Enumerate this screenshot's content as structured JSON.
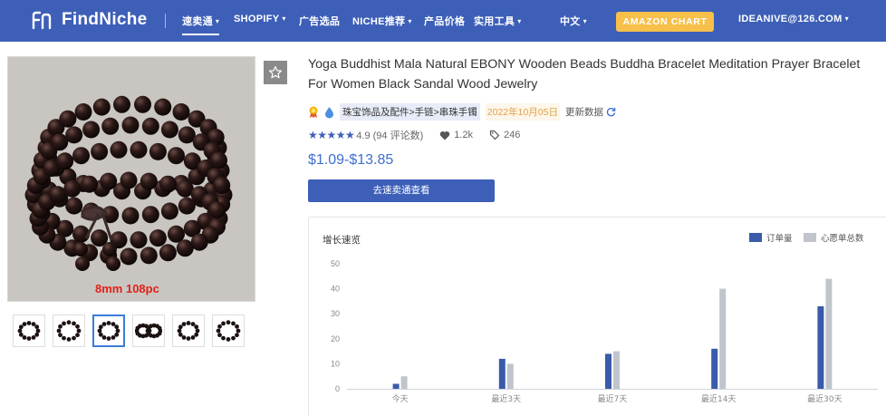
{
  "nav": {
    "brand": "FindNiche",
    "items": [
      {
        "label": "速卖通",
        "caret": true,
        "active": true
      },
      {
        "label": "SHOPIFY",
        "caret": true,
        "active": false
      },
      {
        "label": "广告选品",
        "caret": false,
        "active": false
      },
      {
        "label": "NICHE推荐",
        "caret": true,
        "active": false
      },
      {
        "label": "产品价格",
        "caret": false,
        "active": false
      },
      {
        "label": "实用工具",
        "caret": true,
        "active": false
      }
    ],
    "language": "中文",
    "amazon_button": "AMAZON CHART",
    "account": "IDEANIVE@126.COM"
  },
  "product": {
    "image_caption": "8mm 108pc",
    "thumbnail_count": 6,
    "selected_thumbnail": 2,
    "title": "Yoga Buddhist Mala Natural EBONY Wooden Beads Buddha Bracelet Meditation Prayer Bracelet For Women Black Sandal Wood Jewelry",
    "category": "珠宝饰品及配件>手链>串珠手镯",
    "date": "2022年10月05日",
    "update_label": "更新数据",
    "rating_stars": "★★★★★",
    "rating_text": "4.9 (94 评论数)",
    "rating": 4.9,
    "likes": "1.2k",
    "tags": "246",
    "price": "$1.09-$13.85",
    "cta_label": "去速卖通查看"
  },
  "colors": {
    "nav_bg": "#3d5fb8",
    "accent_amber": "#f7c04a",
    "price_blue": "#3d6fd0",
    "series_orders": "#3a5ba9",
    "series_wishlist": "#c0c4cc"
  },
  "chart_data": {
    "type": "bar",
    "title": "增长速览",
    "categories": [
      "今天",
      "最近3天",
      "最近7天",
      "最近14天",
      "最近30天"
    ],
    "series": [
      {
        "name": "订单量",
        "values": [
          2,
          12,
          14,
          16,
          33
        ]
      },
      {
        "name": "心愿单总数",
        "values": [
          5,
          10,
          15,
          40,
          44
        ]
      }
    ],
    "ylim": [
      0,
      50
    ],
    "yticks": [
      0,
      10,
      20,
      30,
      40,
      50
    ],
    "legend": "top-right",
    "grid": false
  }
}
